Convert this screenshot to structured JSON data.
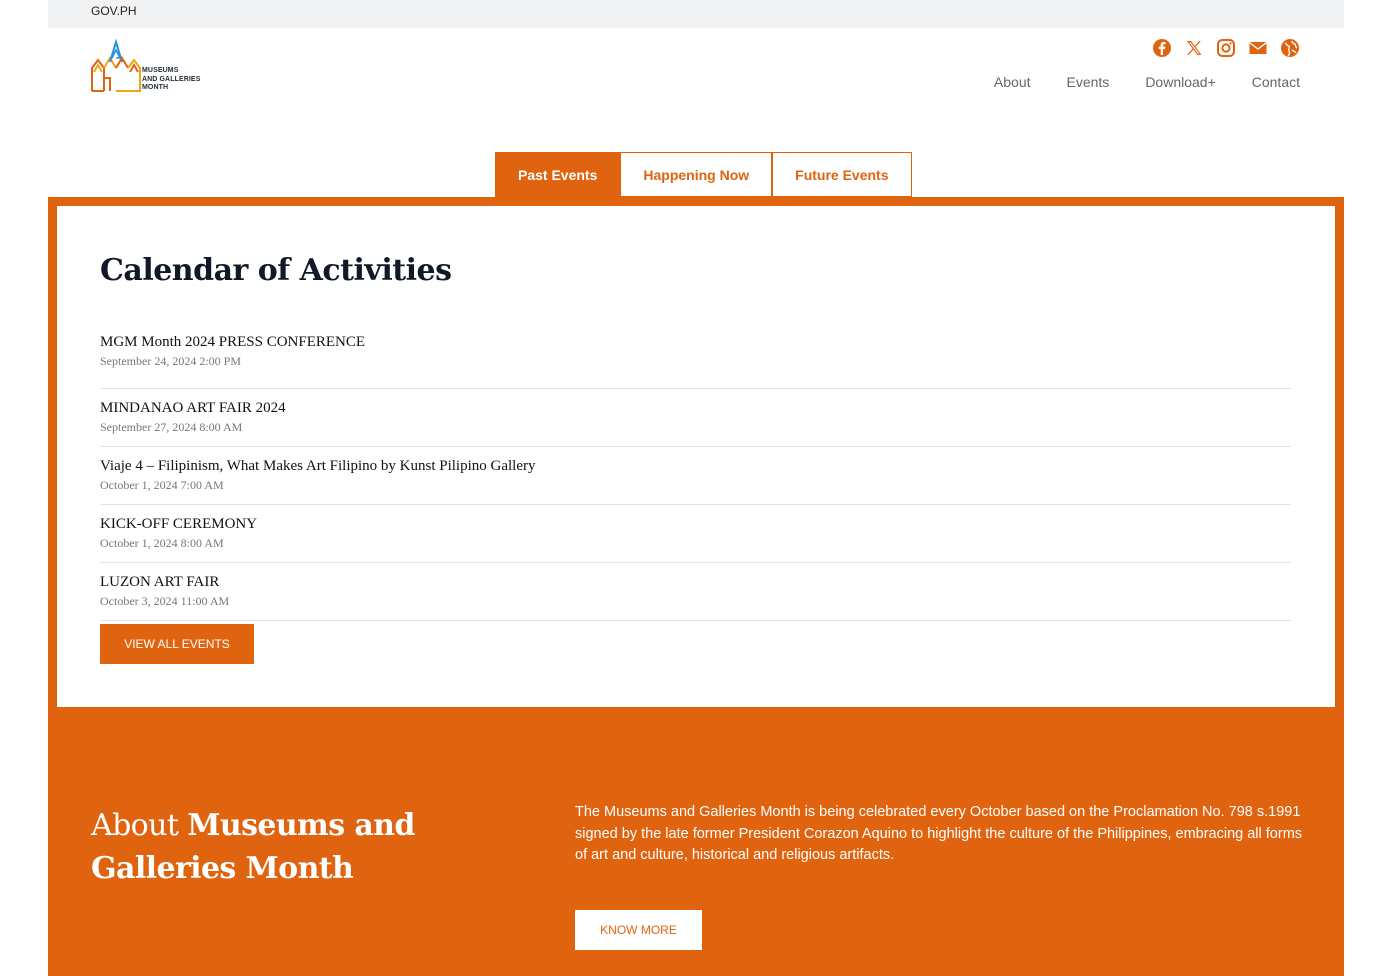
{
  "govbar": {
    "label": "GOV.PH"
  },
  "logo": {
    "line1": "MUSEUMS",
    "line2": "AND GALLERIES",
    "line3": "MONTH"
  },
  "social": [
    {
      "icon": "facebook-icon"
    },
    {
      "icon": "x-twitter-icon"
    },
    {
      "icon": "instagram-icon"
    },
    {
      "icon": "email-icon"
    },
    {
      "icon": "globe-icon"
    }
  ],
  "nav": {
    "about": "About",
    "events": "Events",
    "download": "Download+",
    "contact": "Contact"
  },
  "tabs": {
    "past": "Past Events",
    "now": "Happening Now",
    "future": "Future Events"
  },
  "calendar": {
    "title": "Calendar of Activities",
    "events": [
      {
        "title": "MGM Month 2024 PRESS CONFERENCE",
        "date": "September 24, 2024 2:00 PM"
      },
      {
        "title": "MINDANAO ART FAIR 2024",
        "date": "September 27, 2024 8:00 AM"
      },
      {
        "title": "Viaje 4 – Filipinism, What Makes Art Filipino by Kunst Pilipino Gallery",
        "date": "October 1, 2024 7:00 AM"
      },
      {
        "title": "KICK-OFF CEREMONY",
        "date": "October 1, 2024 8:00 AM"
      },
      {
        "title": "LUZON ART FAIR",
        "date": "October 3, 2024 11:00 AM"
      }
    ],
    "view_all": "VIEW ALL EVENTS"
  },
  "about": {
    "title_light": "About ",
    "title_bold": "Museums and Galleries Month",
    "description": "The Museums and Galleries Month is being celebrated every October based on the Proclamation No. 798 s.1991 signed by the late former President Corazon Aquino to highlight the culture of the Philippines, embracing all forms of art and culture, historical and religious artifacts.",
    "button": "KNOW MORE"
  },
  "colors": {
    "accent": "#e06410",
    "govbar": "#f1f2f3",
    "text_dark": "#111827"
  }
}
